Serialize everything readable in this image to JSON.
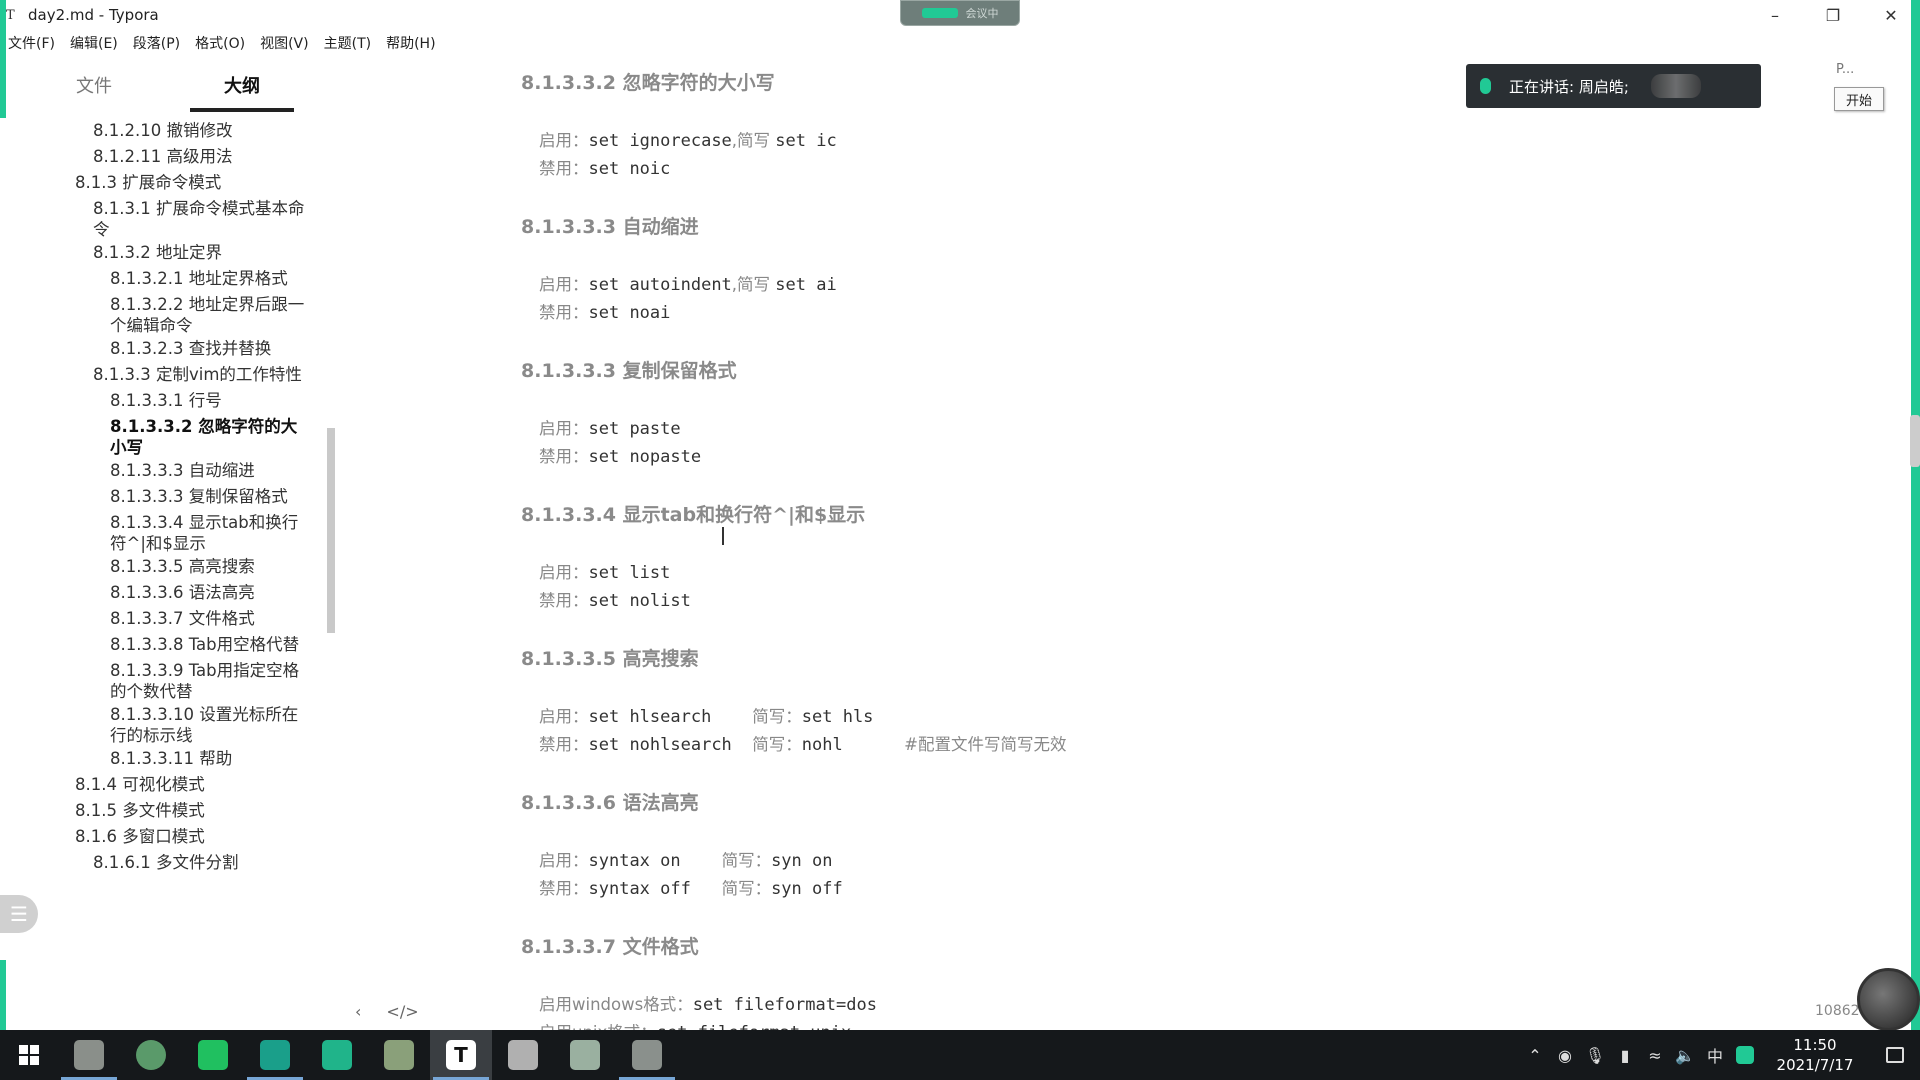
{
  "window": {
    "app_glyph": "T",
    "title": "day2.md - Typora"
  },
  "overlay": {
    "text": "会议中"
  },
  "menu": [
    "文件(F)",
    "编辑(E)",
    "段落(P)",
    "格式(O)",
    "视图(V)",
    "主题(T)",
    "帮助(H)"
  ],
  "sidebar": {
    "tabs": {
      "files": "文件",
      "outline": "大纲"
    },
    "outline": [
      {
        "text": "8.1.2.10 撤销修改",
        "level": 2
      },
      {
        "text": "8.1.2.11 高级用法",
        "level": 2
      },
      {
        "text": "8.1.3 扩展命令模式",
        "level": 1
      },
      {
        "text": "8.1.3.1 扩展命令模式基本命令",
        "level": 2
      },
      {
        "text": "8.1.3.2 地址定界",
        "level": 2
      },
      {
        "text": "8.1.3.2.1 地址定界格式",
        "level": 3
      },
      {
        "text": "8.1.3.2.2 地址定界后跟一个编辑命令",
        "level": 3
      },
      {
        "text": "8.1.3.2.3 查找并替换",
        "level": 3
      },
      {
        "text": "8.1.3.3 定制vim的工作特性",
        "level": 2
      },
      {
        "text": "8.1.3.3.1 行号",
        "level": 3
      },
      {
        "text": "8.1.3.3.2 忽略字符的大小写",
        "level": 3,
        "active": true
      },
      {
        "text": "8.1.3.3.3 自动缩进",
        "level": 3
      },
      {
        "text": "8.1.3.3.3 复制保留格式",
        "level": 3
      },
      {
        "text": "8.1.3.3.4 显示tab和换行符^|和$显示",
        "level": 3
      },
      {
        "text": "8.1.3.3.5 高亮搜索",
        "level": 3
      },
      {
        "text": "8.1.3.3.6 语法高亮",
        "level": 3
      },
      {
        "text": "8.1.3.3.7 文件格式",
        "level": 3
      },
      {
        "text": "8.1.3.3.8 Tab用空格代替",
        "level": 3
      },
      {
        "text": "8.1.3.3.9 Tab用指定空格的个数代替",
        "level": 3
      },
      {
        "text": "8.1.3.3.10 设置光标所在行的标示线",
        "level": 3
      },
      {
        "text": "8.1.3.3.11 帮助",
        "level": 3
      },
      {
        "text": "8.1.4 可视化模式",
        "level": 1
      },
      {
        "text": "8.1.5 多文件模式",
        "level": 1
      },
      {
        "text": "8.1.6 多窗口模式",
        "level": 1
      },
      {
        "text": "8.1.6.1 多文件分割",
        "level": 2
      }
    ],
    "bottom_prev": "‹",
    "bottom_source": "</>"
  },
  "content": {
    "sections": [
      {
        "heading": "8.1.3.3.2 忽略字符的大小写",
        "lines": [
          [
            {
              "t": "启用："
            },
            {
              "c": "set ignorecase"
            },
            {
              "t": ",简写 "
            },
            {
              "c": "set ic"
            }
          ],
          [
            {
              "t": "禁用："
            },
            {
              "c": "set noic"
            }
          ]
        ]
      },
      {
        "heading": "8.1.3.3.3 自动缩进",
        "lines": [
          [
            {
              "t": "启用："
            },
            {
              "c": "set autoindent"
            },
            {
              "t": ",简写 "
            },
            {
              "c": "set ai"
            }
          ],
          [
            {
              "t": "禁用："
            },
            {
              "c": "set noai"
            }
          ]
        ]
      },
      {
        "heading": "8.1.3.3.3 复制保留格式",
        "lines": [
          [
            {
              "t": "启用："
            },
            {
              "c": "set paste"
            }
          ],
          [
            {
              "t": "禁用："
            },
            {
              "c": "set nopaste"
            }
          ]
        ]
      },
      {
        "heading": "8.1.3.3.4  显示tab和换行符^|和$显示",
        "lines": [
          [
            {
              "t": "启用："
            },
            {
              "c": "set list"
            }
          ],
          [
            {
              "t": "禁用："
            },
            {
              "c": "set nolist"
            }
          ]
        ]
      },
      {
        "heading": "8.1.3.3.5 高亮搜索",
        "lines": [
          [
            {
              "t": "启用："
            },
            {
              "c": "set hlsearch    "
            },
            {
              "t": "简写："
            },
            {
              "c": "set hls"
            }
          ],
          [
            {
              "t": "禁用："
            },
            {
              "c": "set nohlsearch  "
            },
            {
              "t": "简写："
            },
            {
              "c": "nohl      "
            },
            {
              "t": "#配置文件写简写无效"
            }
          ]
        ]
      },
      {
        "heading": "8.1.3.3.6 语法高亮",
        "lines": [
          [
            {
              "t": "启用："
            },
            {
              "c": "syntax on    "
            },
            {
              "t": "简写："
            },
            {
              "c": "syn on"
            }
          ],
          [
            {
              "t": "禁用："
            },
            {
              "c": "syntax off   "
            },
            {
              "t": "简写："
            },
            {
              "c": "syn off"
            }
          ]
        ]
      },
      {
        "heading": "8.1.3.3.7 文件格式",
        "lines": [
          [
            {
              "t": "启用windows格式："
            },
            {
              "c": "set fileformat=dos"
            }
          ],
          [
            {
              "t": "启用unix格式："
            },
            {
              "c": "set fileformat=unix"
            }
          ]
        ]
      }
    ]
  },
  "meeting": {
    "speaking": "正在讲话: 周启皓;",
    "panel_label": "P...",
    "start_button": "开始"
  },
  "status": {
    "word_count": "10862"
  },
  "taskbar": {
    "apps": [
      {
        "name": "photo-viewer",
        "color": "#8a8f8a",
        "open": true
      },
      {
        "name": "chrome",
        "color": "#5a9a6a",
        "open": false
      },
      {
        "name": "wechat",
        "color": "#20c060",
        "open": false
      },
      {
        "name": "virtual-machine",
        "color": "#1a9f8a",
        "open": true
      },
      {
        "name": "photos",
        "color": "#20b48a",
        "open": false
      },
      {
        "name": "file-explorer",
        "color": "#8aa07a",
        "open": false
      },
      {
        "name": "typora",
        "color": "#ffffff",
        "open": true,
        "active": true
      },
      {
        "name": "swirl-app",
        "color": "#b0b0b0",
        "open": false
      },
      {
        "name": "notepad",
        "color": "#9ab0a0",
        "open": false
      },
      {
        "name": "image-app",
        "color": "#8a908c",
        "open": true
      }
    ],
    "tray": {
      "ime": "中",
      "time": "11:50",
      "date": "2021/7/17"
    }
  },
  "colors": {
    "accent": "#21c995",
    "taskbar": "#15181b"
  }
}
